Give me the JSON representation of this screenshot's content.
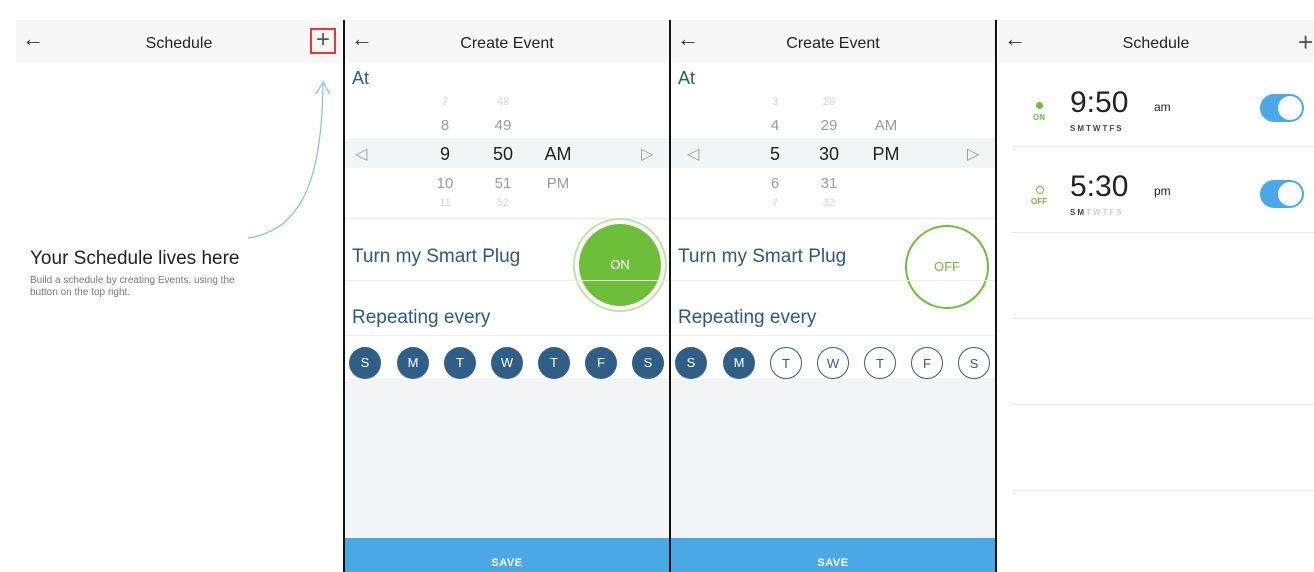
{
  "colors": {
    "accent": "#4aa8e6",
    "brand_green": "#6dbf3a",
    "navy": "#2f5f86",
    "highlight_red": "#e53935"
  },
  "icons": {
    "back": "arrow-left",
    "add": "plus",
    "arrow_left_picker": "triangle-left",
    "arrow_right_picker": "triangle-right"
  },
  "glyphs": {
    "back": "←",
    "plus": "+",
    "left": "◁",
    "right": "▷"
  },
  "panel1": {
    "title": "Schedule",
    "empty_title": "Your Schedule lives here",
    "empty_subtitle": "Build a schedule by creating Events, using the button on the top right."
  },
  "panel2": {
    "title": "Create Event",
    "at_label": "At",
    "picker": {
      "hours": [
        "7",
        "8",
        "9",
        "10",
        "11"
      ],
      "minutes": [
        "48",
        "49",
        "50",
        "51",
        "52"
      ],
      "meridiem": [
        "AM",
        "PM"
      ]
    },
    "turn_label": "Turn my Smart Plug",
    "toggle": "ON",
    "repeat_label": "Repeating every",
    "days": [
      "S",
      "M",
      "T",
      "W",
      "T",
      "F",
      "S"
    ],
    "save": "SAVE"
  },
  "panel3": {
    "title": "Create Event",
    "at_label": "At",
    "picker": {
      "hours": [
        "3",
        "4",
        "5",
        "6",
        "7"
      ],
      "minutes": [
        "28",
        "29",
        "30",
        "31",
        "32"
      ],
      "meridiem": [
        "AM",
        "PM"
      ]
    },
    "turn_label": "Turn my Smart Plug",
    "toggle": "OFF",
    "repeat_label": "Repeating every",
    "days": [
      "S",
      "M",
      "T",
      "W",
      "T",
      "F",
      "S"
    ],
    "save": "SAVE"
  },
  "panel4": {
    "title": "Schedule",
    "events": [
      {
        "status": "ON",
        "time": "9:50",
        "ampm": "am",
        "days": [
          "S",
          "M",
          "T",
          "W",
          "T",
          "F",
          "S"
        ]
      },
      {
        "status": "OFF",
        "time": "5:30",
        "ampm": "pm",
        "days": [
          "S",
          "M",
          "T",
          "W",
          "T",
          "F",
          "S"
        ]
      }
    ]
  }
}
